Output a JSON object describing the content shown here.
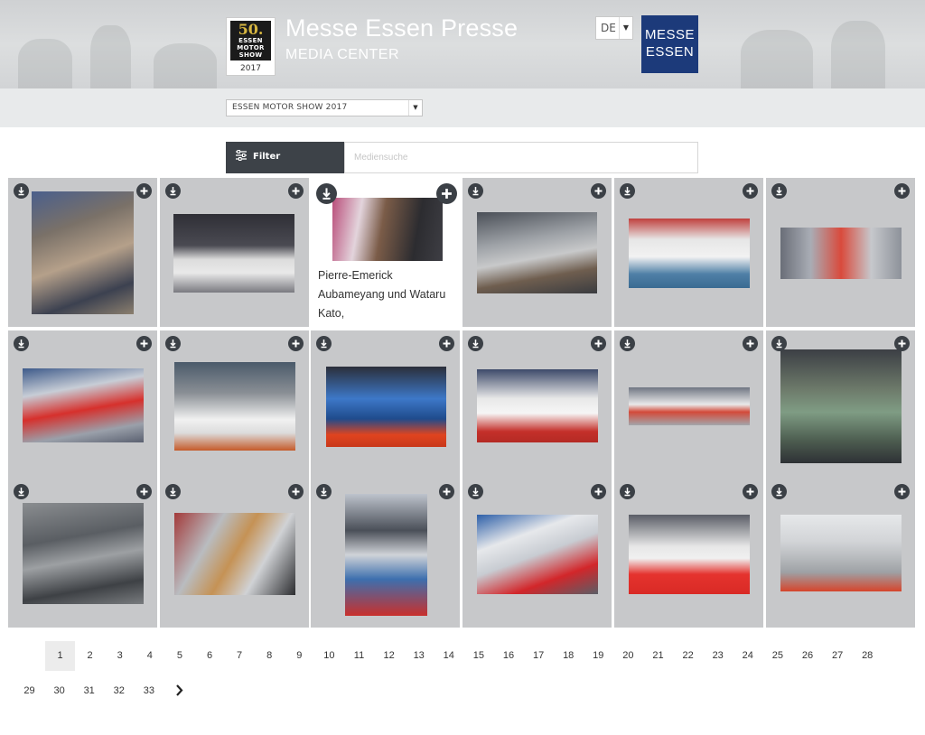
{
  "header": {
    "logo": {
      "number": "50.",
      "line1": "ESSEN",
      "line2": "MOTOR",
      "line3": "SHOW",
      "year": "2017"
    },
    "title": "Messe Essen Presse",
    "subtitle": "MEDIA CENTER",
    "language": "DE",
    "brand_logo": {
      "line1": "MESSE",
      "line2": "ESSEN",
      "color": "#1c3a7a"
    }
  },
  "event_select": {
    "selected": "ESSEN MOTOR SHOW 2017"
  },
  "filter": {
    "label": "Filter",
    "search_placeholder": "Mediensuche"
  },
  "gallery": {
    "hover_caption": "Pierre-Emerick Aubameyang und Wataru Kato,",
    "icons": {
      "download": "download-icon",
      "add": "plus-icon"
    }
  },
  "pagination": {
    "current": "1",
    "pages": [
      "1",
      "2",
      "3",
      "4",
      "5",
      "6",
      "7",
      "8",
      "9",
      "10",
      "11",
      "12",
      "13",
      "14",
      "15",
      "16",
      "17",
      "18",
      "19",
      "20",
      "21",
      "22",
      "23",
      "24",
      "25",
      "26",
      "27",
      "28",
      "29",
      "30",
      "31",
      "32",
      "33"
    ],
    "next_icon": "chevron-right-icon"
  },
  "colors": {
    "dark": "#3d4248",
    "tile_bg": "#c7c8ca",
    "brand": "#1c3a7a"
  }
}
